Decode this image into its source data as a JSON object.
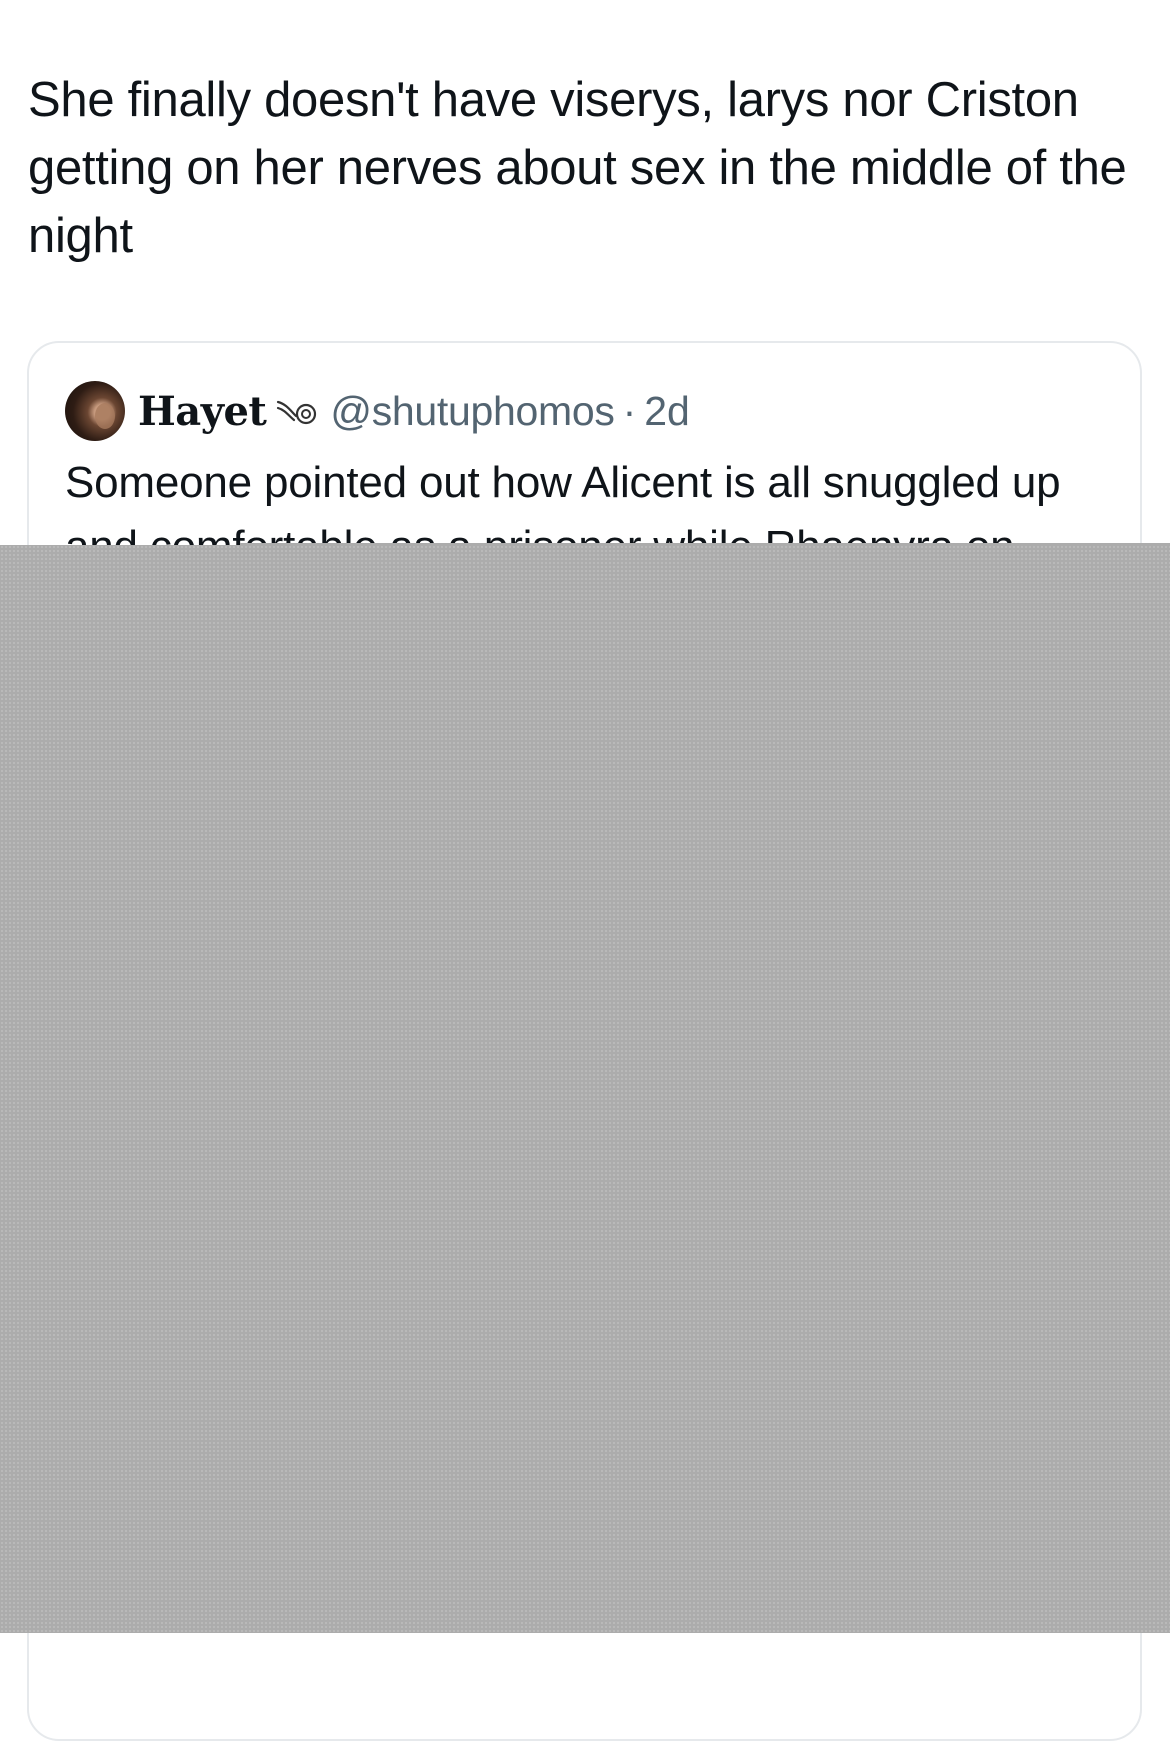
{
  "tweet": {
    "text": "She finally doesn't have viserys, larys nor Criston getting on her nerves about sex in the middle of the night"
  },
  "quoted_tweet": {
    "display_name": "Hayet",
    "name_emoji": "swirl-emoji-icon",
    "handle": "@shutuphomos",
    "separator": "·",
    "timestamp": "2d",
    "text": "Someone pointed out how Alicent is all snuggled up and comfortable as a prisoner while Rhaenyra on"
  },
  "colors": {
    "text_primary": "#0f1419",
    "text_secondary": "#536471",
    "card_border": "#e6e9ec",
    "redaction": "#acacac"
  }
}
